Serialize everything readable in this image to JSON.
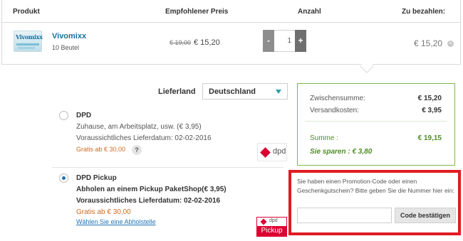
{
  "table": {
    "headers": {
      "produkt": "Produkt",
      "preis": "Empfohlener Preis",
      "anzahl": "Anzahl",
      "zahlen": "Zu bezahlen:"
    }
  },
  "product": {
    "image_brand": "Vivomixx",
    "name": "Vivomixx",
    "quantity_desc": "10 Beutel",
    "old_price": "€ 19,00",
    "new_price": "€ 15,20",
    "quantity": "1",
    "minus_label": "-",
    "plus_label": "+",
    "total": "€ 15,20",
    "remove_symbol": "×"
  },
  "shipping": {
    "country_label": "Lieferland",
    "country_value": "Deutschland",
    "options": [
      {
        "title": "DPD",
        "line1": "Zuhause, am Arbeitsplatz, usw. (€ 3,95)",
        "line2": "Voraussichtliches Lieferdatum: 02-02-2016",
        "free": "Gratis ab € 30,00",
        "help": "?",
        "logo_text": "dpd",
        "selected": false
      },
      {
        "title": "DPD Pickup",
        "line1": "Abholen an einem Pickup PaketShop(€ 3,95)",
        "line2": "Voraussichtliches Lieferdatum: 02-02-2016",
        "free": "Gratis ab € 30,00",
        "link": "Wählen Sie eine Abholstelle",
        "logo_text": "dpd",
        "logo_sub": "Pickup",
        "selected": true
      }
    ]
  },
  "summary": {
    "subtotal_label": "Zwischensumme:",
    "subtotal_value": "€ 15,20",
    "shipping_label": "Versandkosten:",
    "shipping_value": "€ 3,95",
    "total_label": "Summe :",
    "total_value": "€ 19,15",
    "savings": "Sie sparen : € 3,80"
  },
  "promo": {
    "text": "Sie haben einen Promotion-Code oder einen Geschenkgutschein? Bitte geben Sie die Nummer hier ein:",
    "input_value": "",
    "button_label": "Code bestätigen"
  },
  "colors": {
    "accent_blue": "#1c74b8",
    "summary_green": "#4e8d26",
    "promo_red": "#e01b22",
    "dpd_red": "#dc0032"
  }
}
